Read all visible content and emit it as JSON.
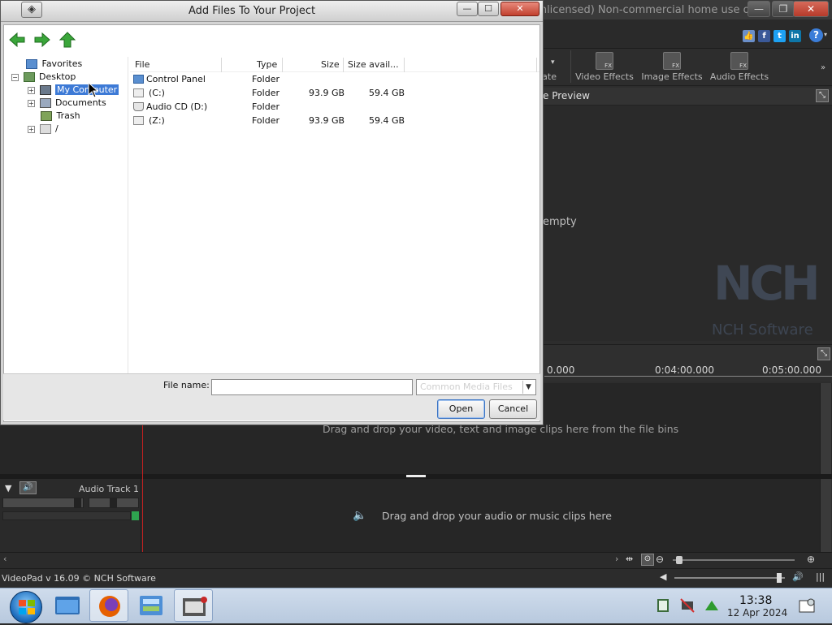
{
  "app": {
    "title": "VideoPad Video Editor by NCH Software - (Unlicensed) Non-commercial home use only",
    "toolbar": [
      {
        "label": "ate",
        "icon": "transition-icon"
      },
      {
        "label": "Video Effects",
        "icon": "video-effects-icon"
      },
      {
        "label": "Image Effects",
        "icon": "image-effects-icon"
      },
      {
        "label": "Audio Effects",
        "icon": "audio-effects-icon"
      }
    ],
    "preview_title": "e Preview",
    "preview_empty": "empty",
    "logo_main": "NCH",
    "logo_sub": "NCH Software",
    "ruler": [
      "0.000",
      "0:04:00.000",
      "0:05:00.000"
    ],
    "video_drop_hint": "Drag and drop your video, text and image clips here from the file bins",
    "audio_track_name": "Audio Track 1",
    "audio_drop_hint": "Drag and drop your audio or music clips here",
    "status": "VideoPad v 16.09 © NCH Software"
  },
  "dialog": {
    "title": "Add Files To Your Project",
    "tree": [
      {
        "label": "Favorites",
        "icon": "favorites-folder-icon",
        "indent": 0,
        "expander": ""
      },
      {
        "label": "Desktop",
        "icon": "desktop-icon",
        "indent": 0,
        "expander": "−"
      },
      {
        "label": "My Computer",
        "icon": "computer-icon",
        "indent": 1,
        "expander": "+",
        "selected": true
      },
      {
        "label": "Documents",
        "icon": "documents-folder-icon",
        "indent": 1,
        "expander": "+"
      },
      {
        "label": "Trash",
        "icon": "trash-icon",
        "indent": 1,
        "expander": ""
      },
      {
        "label": "/",
        "icon": "drive-icon",
        "indent": 1,
        "expander": "+"
      }
    ],
    "columns": {
      "file": "File",
      "type": "Type",
      "size": "Size",
      "avail": "Size avail..."
    },
    "files": [
      {
        "name": "Control Panel",
        "type": "Folder",
        "size": "",
        "avail": "",
        "icon": "folder-icon"
      },
      {
        "name": "(C:)",
        "type": "Folder",
        "size": "93.9 GB",
        "avail": "59.4 GB",
        "icon": "drive-icon"
      },
      {
        "name": "Audio CD (D:)",
        "type": "Folder",
        "size": "",
        "avail": "",
        "icon": "cd-drive-icon"
      },
      {
        "name": "(Z:)",
        "type": "Folder",
        "size": "93.9 GB",
        "avail": "59.4 GB",
        "icon": "drive-icon"
      }
    ],
    "file_name_label": "File name:",
    "file_name_value": "",
    "filter": "Common Media Files",
    "open_label": "Open",
    "cancel_label": "Cancel"
  },
  "taskbar": {
    "time": "13:38",
    "date": "12 Apr 2024"
  },
  "colors": {
    "accent_selection": "#3d7ad6",
    "nav_arrow": "#2e9b2e",
    "playhead": "#c02020"
  }
}
